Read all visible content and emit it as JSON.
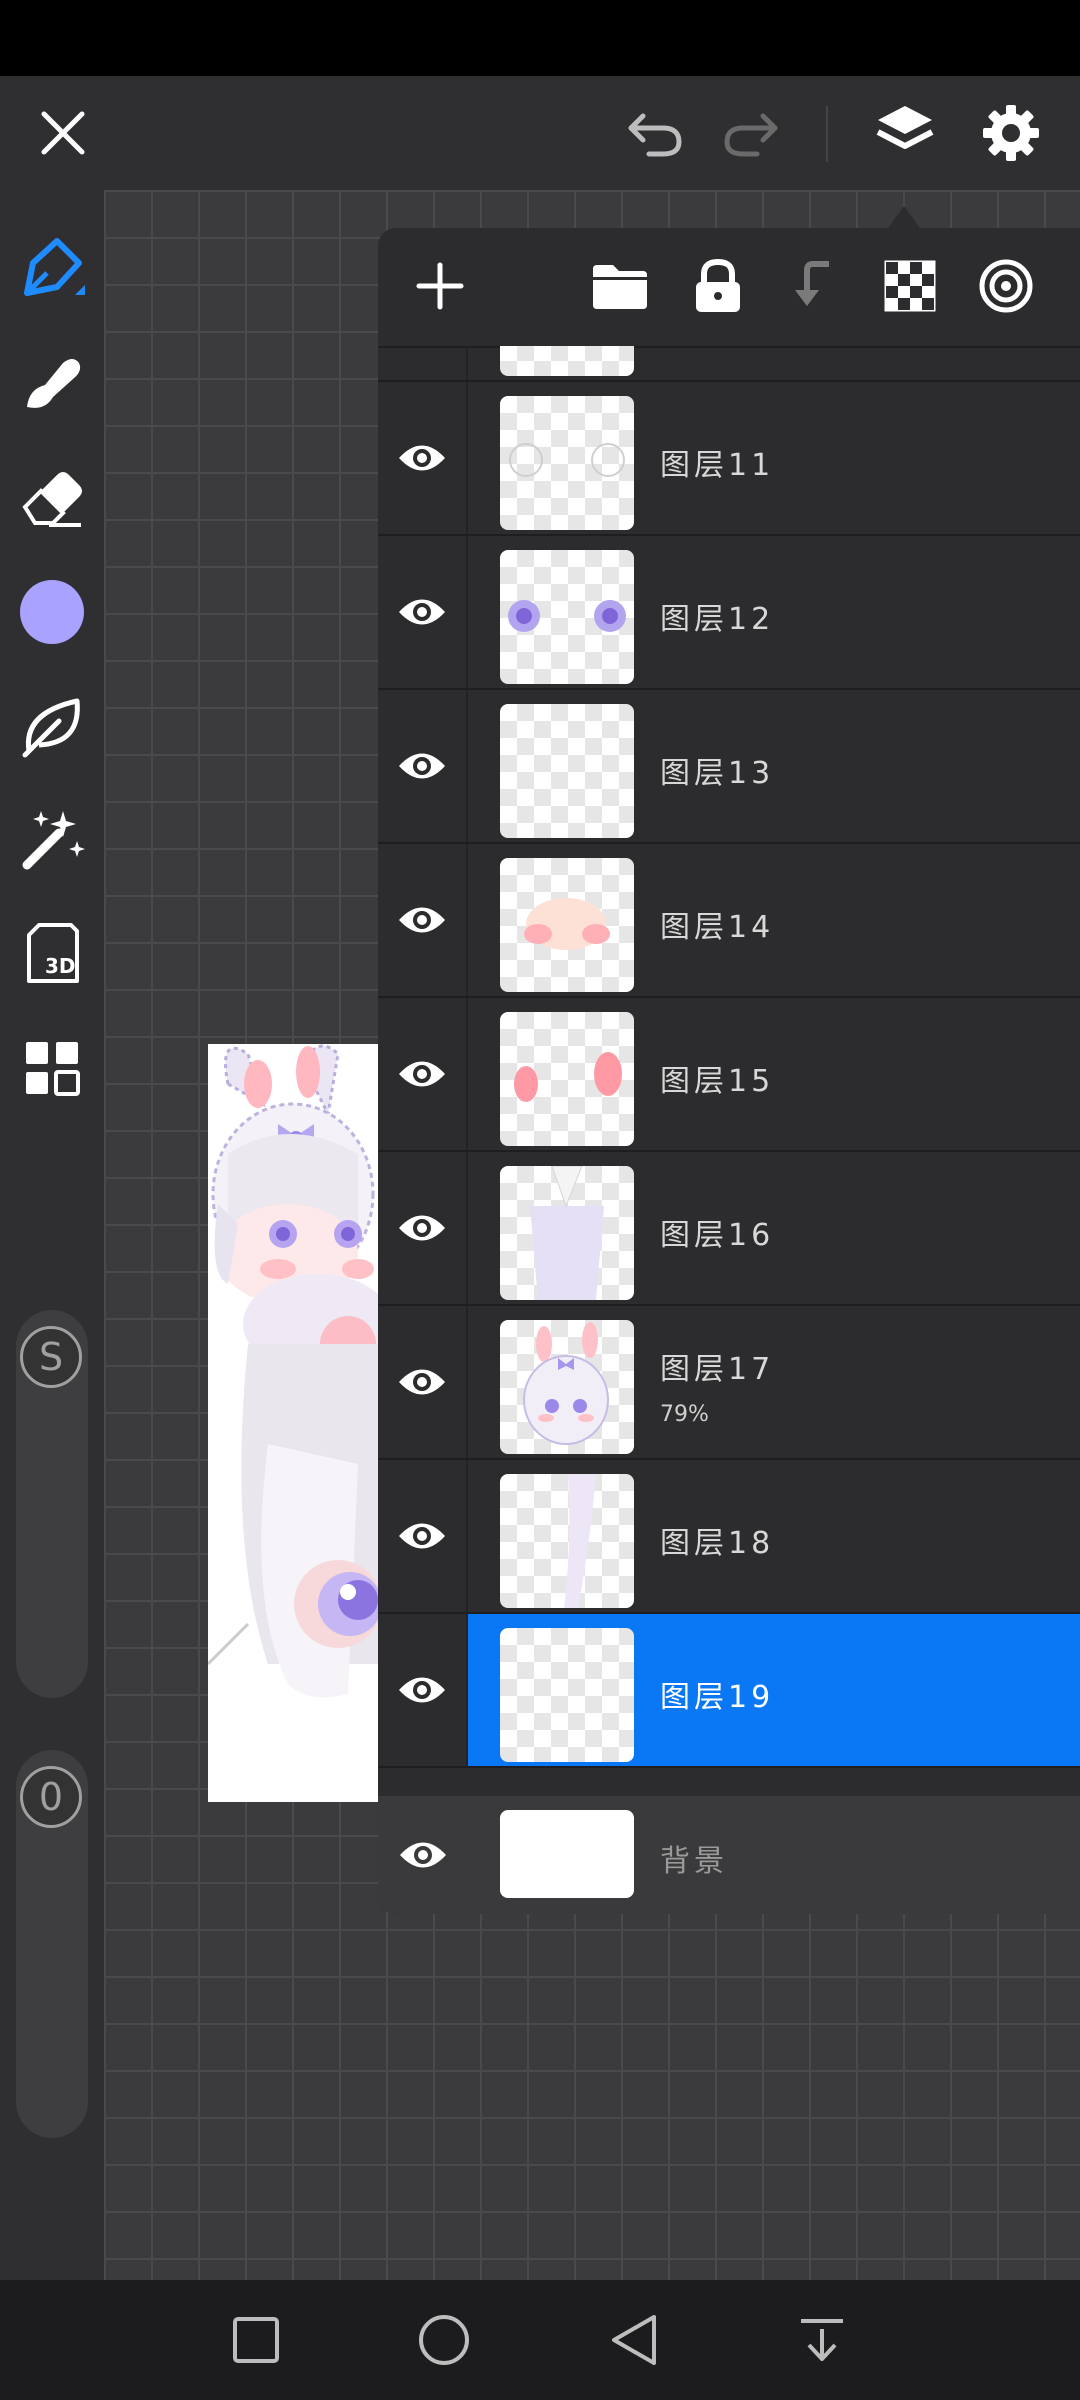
{
  "top_toolbar": {
    "icons": [
      "close-icon",
      "undo-icon",
      "redo-icon",
      "layers-icon",
      "settings-icon"
    ]
  },
  "left_toolbar": {
    "tools": [
      "pen-tool-icon",
      "smudge-tool-icon",
      "eraser-icon",
      "color-swatch",
      "leaf-brush-icon",
      "magic-wand-icon",
      "3d-layer-icon",
      "grid-menu-icon"
    ],
    "color": "#a9a2ff",
    "size_slider_label": "S",
    "opacity_slider_label": "0"
  },
  "layers_panel": {
    "header_icons": [
      "add-layer-icon",
      "folder-icon",
      "lock-icon",
      "merge-down-icon",
      "checker-icon",
      "target-icon"
    ],
    "layers": [
      {
        "name": "图层11",
        "opacity": ""
      },
      {
        "name": "图层12",
        "opacity": ""
      },
      {
        "name": "图层13",
        "opacity": ""
      },
      {
        "name": "图层14",
        "opacity": ""
      },
      {
        "name": "图层15",
        "opacity": ""
      },
      {
        "name": "图层16",
        "opacity": ""
      },
      {
        "name": "图层17",
        "opacity": "79%"
      },
      {
        "name": "图层18",
        "opacity": ""
      },
      {
        "name": "图层19",
        "opacity": "",
        "selected": true
      }
    ],
    "background_layer": {
      "name": "背景"
    }
  },
  "colors": {
    "accent": "#0a78f5",
    "panel": "#2c2c2e",
    "toolbar": "#2f2f31"
  },
  "nav_bar": {
    "icons": [
      "recents-icon",
      "home-icon",
      "back-icon",
      "collapse-icon"
    ]
  }
}
